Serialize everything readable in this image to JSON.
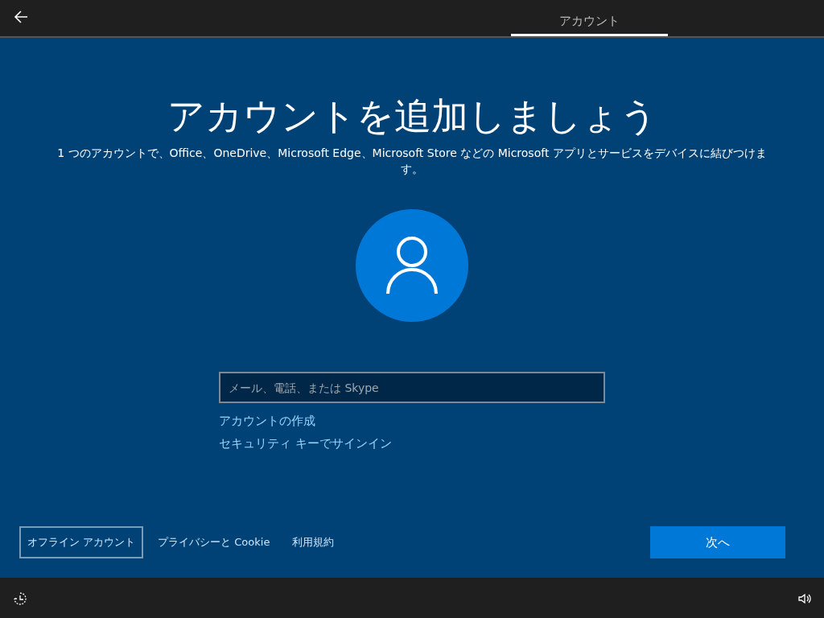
{
  "header": {
    "tabs": [
      {
        "label": "アカウント",
        "selected": true
      }
    ]
  },
  "heading": "アカウントを追加しましょう",
  "description": "1 つのアカウントで、Office、OneDrive、Microsoft Edge、Microsoft Store などの Microsoft アプリとサービスをデバイスに結びつけます。",
  "sign_in": {
    "placeholder": "メール、電話、または Skype"
  },
  "links": [
    "アカウントの作成",
    "セキュリティ キーでサインイン"
  ],
  "footer": {
    "links": [
      {
        "label": "オフライン アカウント",
        "focused": true
      },
      {
        "label": "プライバシーと Cookie",
        "focused": false
      },
      {
        "label": "利用規約",
        "focused": false
      }
    ],
    "next_button": "次へ"
  }
}
